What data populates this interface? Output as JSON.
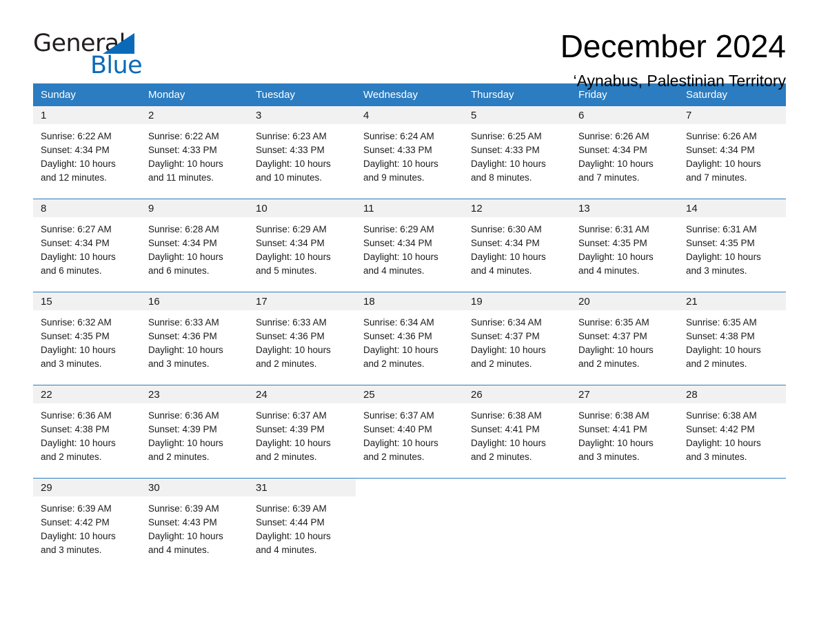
{
  "brand": {
    "name_part1": "General",
    "name_part2": "Blue",
    "triangle_icon": "triangle-icon",
    "accent_color": "#0b6ab8"
  },
  "header": {
    "month_title": "December 2024",
    "location": "‘Aynabus, Palestinian Territory"
  },
  "calendar": {
    "header_bg": "#2b7cc0",
    "daynum_band_bg": "#f1f1f1",
    "weekdays": [
      "Sunday",
      "Monday",
      "Tuesday",
      "Wednesday",
      "Thursday",
      "Friday",
      "Saturday"
    ],
    "weeks": [
      [
        {
          "day": "1",
          "sunrise": "Sunrise: 6:22 AM",
          "sunset": "Sunset: 4:34 PM",
          "daylight_line1": "Daylight: 10 hours",
          "daylight_line2": "and 12 minutes."
        },
        {
          "day": "2",
          "sunrise": "Sunrise: 6:22 AM",
          "sunset": "Sunset: 4:33 PM",
          "daylight_line1": "Daylight: 10 hours",
          "daylight_line2": "and 11 minutes."
        },
        {
          "day": "3",
          "sunrise": "Sunrise: 6:23 AM",
          "sunset": "Sunset: 4:33 PM",
          "daylight_line1": "Daylight: 10 hours",
          "daylight_line2": "and 10 minutes."
        },
        {
          "day": "4",
          "sunrise": "Sunrise: 6:24 AM",
          "sunset": "Sunset: 4:33 PM",
          "daylight_line1": "Daylight: 10 hours",
          "daylight_line2": "and 9 minutes."
        },
        {
          "day": "5",
          "sunrise": "Sunrise: 6:25 AM",
          "sunset": "Sunset: 4:33 PM",
          "daylight_line1": "Daylight: 10 hours",
          "daylight_line2": "and 8 minutes."
        },
        {
          "day": "6",
          "sunrise": "Sunrise: 6:26 AM",
          "sunset": "Sunset: 4:34 PM",
          "daylight_line1": "Daylight: 10 hours",
          "daylight_line2": "and 7 minutes."
        },
        {
          "day": "7",
          "sunrise": "Sunrise: 6:26 AM",
          "sunset": "Sunset: 4:34 PM",
          "daylight_line1": "Daylight: 10 hours",
          "daylight_line2": "and 7 minutes."
        }
      ],
      [
        {
          "day": "8",
          "sunrise": "Sunrise: 6:27 AM",
          "sunset": "Sunset: 4:34 PM",
          "daylight_line1": "Daylight: 10 hours",
          "daylight_line2": "and 6 minutes."
        },
        {
          "day": "9",
          "sunrise": "Sunrise: 6:28 AM",
          "sunset": "Sunset: 4:34 PM",
          "daylight_line1": "Daylight: 10 hours",
          "daylight_line2": "and 6 minutes."
        },
        {
          "day": "10",
          "sunrise": "Sunrise: 6:29 AM",
          "sunset": "Sunset: 4:34 PM",
          "daylight_line1": "Daylight: 10 hours",
          "daylight_line2": "and 5 minutes."
        },
        {
          "day": "11",
          "sunrise": "Sunrise: 6:29 AM",
          "sunset": "Sunset: 4:34 PM",
          "daylight_line1": "Daylight: 10 hours",
          "daylight_line2": "and 4 minutes."
        },
        {
          "day": "12",
          "sunrise": "Sunrise: 6:30 AM",
          "sunset": "Sunset: 4:34 PM",
          "daylight_line1": "Daylight: 10 hours",
          "daylight_line2": "and 4 minutes."
        },
        {
          "day": "13",
          "sunrise": "Sunrise: 6:31 AM",
          "sunset": "Sunset: 4:35 PM",
          "daylight_line1": "Daylight: 10 hours",
          "daylight_line2": "and 4 minutes."
        },
        {
          "day": "14",
          "sunrise": "Sunrise: 6:31 AM",
          "sunset": "Sunset: 4:35 PM",
          "daylight_line1": "Daylight: 10 hours",
          "daylight_line2": "and 3 minutes."
        }
      ],
      [
        {
          "day": "15",
          "sunrise": "Sunrise: 6:32 AM",
          "sunset": "Sunset: 4:35 PM",
          "daylight_line1": "Daylight: 10 hours",
          "daylight_line2": "and 3 minutes."
        },
        {
          "day": "16",
          "sunrise": "Sunrise: 6:33 AM",
          "sunset": "Sunset: 4:36 PM",
          "daylight_line1": "Daylight: 10 hours",
          "daylight_line2": "and 3 minutes."
        },
        {
          "day": "17",
          "sunrise": "Sunrise: 6:33 AM",
          "sunset": "Sunset: 4:36 PM",
          "daylight_line1": "Daylight: 10 hours",
          "daylight_line2": "and 2 minutes."
        },
        {
          "day": "18",
          "sunrise": "Sunrise: 6:34 AM",
          "sunset": "Sunset: 4:36 PM",
          "daylight_line1": "Daylight: 10 hours",
          "daylight_line2": "and 2 minutes."
        },
        {
          "day": "19",
          "sunrise": "Sunrise: 6:34 AM",
          "sunset": "Sunset: 4:37 PM",
          "daylight_line1": "Daylight: 10 hours",
          "daylight_line2": "and 2 minutes."
        },
        {
          "day": "20",
          "sunrise": "Sunrise: 6:35 AM",
          "sunset": "Sunset: 4:37 PM",
          "daylight_line1": "Daylight: 10 hours",
          "daylight_line2": "and 2 minutes."
        },
        {
          "day": "21",
          "sunrise": "Sunrise: 6:35 AM",
          "sunset": "Sunset: 4:38 PM",
          "daylight_line1": "Daylight: 10 hours",
          "daylight_line2": "and 2 minutes."
        }
      ],
      [
        {
          "day": "22",
          "sunrise": "Sunrise: 6:36 AM",
          "sunset": "Sunset: 4:38 PM",
          "daylight_line1": "Daylight: 10 hours",
          "daylight_line2": "and 2 minutes."
        },
        {
          "day": "23",
          "sunrise": "Sunrise: 6:36 AM",
          "sunset": "Sunset: 4:39 PM",
          "daylight_line1": "Daylight: 10 hours",
          "daylight_line2": "and 2 minutes."
        },
        {
          "day": "24",
          "sunrise": "Sunrise: 6:37 AM",
          "sunset": "Sunset: 4:39 PM",
          "daylight_line1": "Daylight: 10 hours",
          "daylight_line2": "and 2 minutes."
        },
        {
          "day": "25",
          "sunrise": "Sunrise: 6:37 AM",
          "sunset": "Sunset: 4:40 PM",
          "daylight_line1": "Daylight: 10 hours",
          "daylight_line2": "and 2 minutes."
        },
        {
          "day": "26",
          "sunrise": "Sunrise: 6:38 AM",
          "sunset": "Sunset: 4:41 PM",
          "daylight_line1": "Daylight: 10 hours",
          "daylight_line2": "and 2 minutes."
        },
        {
          "day": "27",
          "sunrise": "Sunrise: 6:38 AM",
          "sunset": "Sunset: 4:41 PM",
          "daylight_line1": "Daylight: 10 hours",
          "daylight_line2": "and 3 minutes."
        },
        {
          "day": "28",
          "sunrise": "Sunrise: 6:38 AM",
          "sunset": "Sunset: 4:42 PM",
          "daylight_line1": "Daylight: 10 hours",
          "daylight_line2": "and 3 minutes."
        }
      ],
      [
        {
          "day": "29",
          "sunrise": "Sunrise: 6:39 AM",
          "sunset": "Sunset: 4:42 PM",
          "daylight_line1": "Daylight: 10 hours",
          "daylight_line2": "and 3 minutes."
        },
        {
          "day": "30",
          "sunrise": "Sunrise: 6:39 AM",
          "sunset": "Sunset: 4:43 PM",
          "daylight_line1": "Daylight: 10 hours",
          "daylight_line2": "and 4 minutes."
        },
        {
          "day": "31",
          "sunrise": "Sunrise: 6:39 AM",
          "sunset": "Sunset: 4:44 PM",
          "daylight_line1": "Daylight: 10 hours",
          "daylight_line2": "and 4 minutes."
        },
        {
          "day": "",
          "sunrise": "",
          "sunset": "",
          "daylight_line1": "",
          "daylight_line2": ""
        },
        {
          "day": "",
          "sunrise": "",
          "sunset": "",
          "daylight_line1": "",
          "daylight_line2": ""
        },
        {
          "day": "",
          "sunrise": "",
          "sunset": "",
          "daylight_line1": "",
          "daylight_line2": ""
        },
        {
          "day": "",
          "sunrise": "",
          "sunset": "",
          "daylight_line1": "",
          "daylight_line2": ""
        }
      ]
    ]
  }
}
